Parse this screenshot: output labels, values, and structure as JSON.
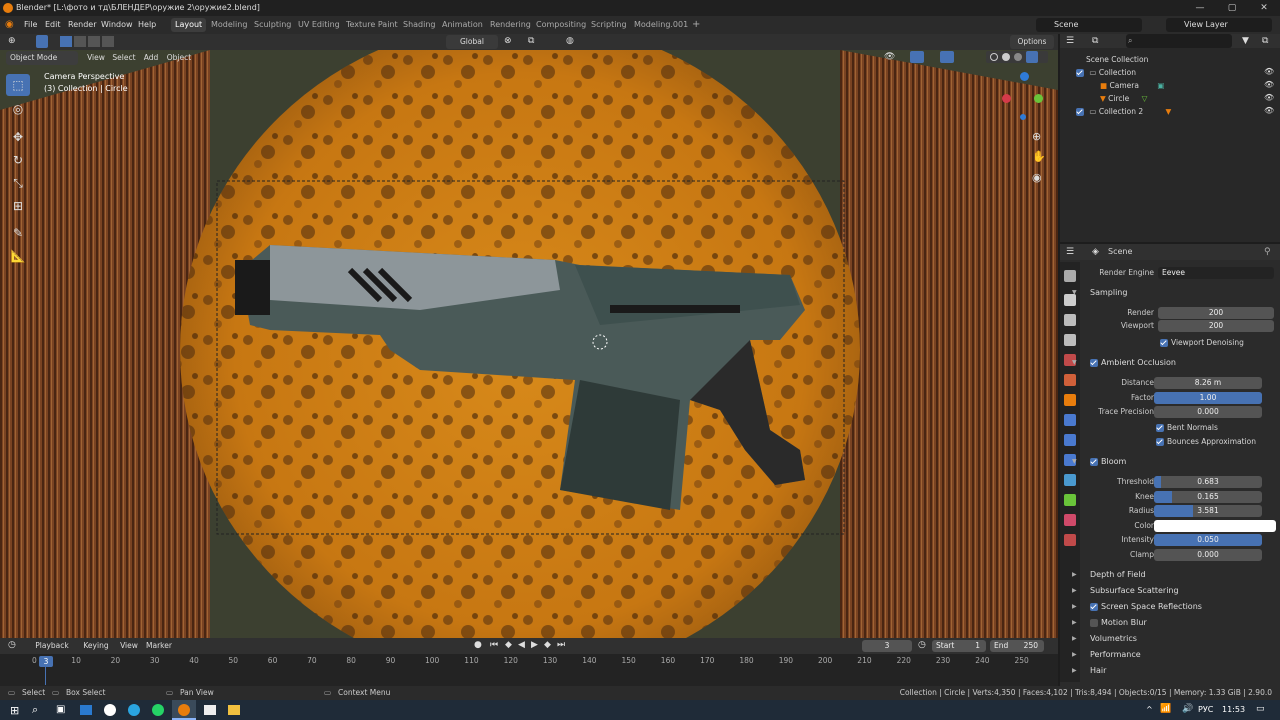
{
  "window": {
    "title": "Blender* [L:\\фото и тд\\БЛЕНДЕР\\оружие 2\\оружие2.blend]"
  },
  "menu": [
    "File",
    "Edit",
    "Render",
    "Window",
    "Help"
  ],
  "workspaces": [
    "Layout",
    "Modeling",
    "Sculpting",
    "UV Editing",
    "Texture Paint",
    "Shading",
    "Animation",
    "Rendering",
    "Compositing",
    "Scripting",
    "Modeling.001"
  ],
  "workspace_add": "+",
  "scene": {
    "name": "Scene",
    "view_layer": "View Layer"
  },
  "viewport": {
    "transform_orientation": "Global",
    "options_label": "Options",
    "mode": "Object Mode",
    "menus": [
      "View",
      "Select",
      "Add",
      "Object"
    ],
    "overlay_line1": "Camera Perspective",
    "overlay_line2": "(3) Collection | Circle"
  },
  "outliner": {
    "root": "Scene Collection",
    "items": [
      {
        "label": "Collection"
      },
      {
        "label": "Camera"
      },
      {
        "label": "Circle"
      },
      {
        "label": "Collection 2"
      }
    ]
  },
  "properties": {
    "header": "Scene",
    "render_engine_label": "Render Engine",
    "render_engine": "Eevee",
    "sampling": {
      "title": "Sampling",
      "render_label": "Render",
      "render": "200",
      "viewport_label": "Viewport",
      "viewport": "200",
      "denoise": "Viewport Denoising"
    },
    "ao": {
      "title": "Ambient Occlusion",
      "distance_label": "Distance",
      "distance": "8.26 m",
      "factor_label": "Factor",
      "factor": "1.00",
      "factor_fill": 1.0,
      "trace_label": "Trace Precision",
      "trace": "0.000",
      "bent": "Bent Normals",
      "bounces": "Bounces Approximation"
    },
    "bloom": {
      "title": "Bloom",
      "threshold_label": "Threshold",
      "threshold": "0.683",
      "threshold_fill": 0.068,
      "knee_label": "Knee",
      "knee": "0.165",
      "knee_fill": 0.165,
      "radius_label": "Radius",
      "radius": "3.581",
      "radius_fill": 0.36,
      "color_label": "Color",
      "color": "#ffffff",
      "intensity_label": "Intensity",
      "intensity": "0.050",
      "intensity_fill": 1.0,
      "clamp_label": "Clamp",
      "clamp": "0.000"
    },
    "panels": [
      "Depth of Field",
      "Subsurface Scattering",
      "Screen Space Reflections",
      "Motion Blur",
      "Volumetrics",
      "Performance",
      "Hair"
    ]
  },
  "timeline": {
    "menus": [
      "Playback",
      "Keying",
      "View",
      "Marker"
    ],
    "current_frame": "3",
    "start_label": "Start",
    "start": "1",
    "end_label": "End",
    "end": "250",
    "ticks": [
      "0",
      "10",
      "20",
      "30",
      "40",
      "50",
      "60",
      "70",
      "80",
      "90",
      "100",
      "110",
      "120",
      "130",
      "140",
      "150",
      "160",
      "170",
      "180",
      "190",
      "200",
      "210",
      "220",
      "230",
      "240",
      "250"
    ],
    "cursor": "3"
  },
  "status": {
    "select": "Select",
    "box_select": "Box Select",
    "pan_view": "Pan View",
    "context_menu": "Context Menu",
    "stats": "Collection | Circle | Verts:4,350 | Faces:4,102 | Tris:8,494 | Objects:0/15 | Memory: 1.33 GiB | 2.90.0"
  },
  "taskbar": {
    "lang": "РУС",
    "time": "11:53"
  },
  "colors": {
    "accent": "#4772b3",
    "blender_orange": "#e87d0d"
  }
}
